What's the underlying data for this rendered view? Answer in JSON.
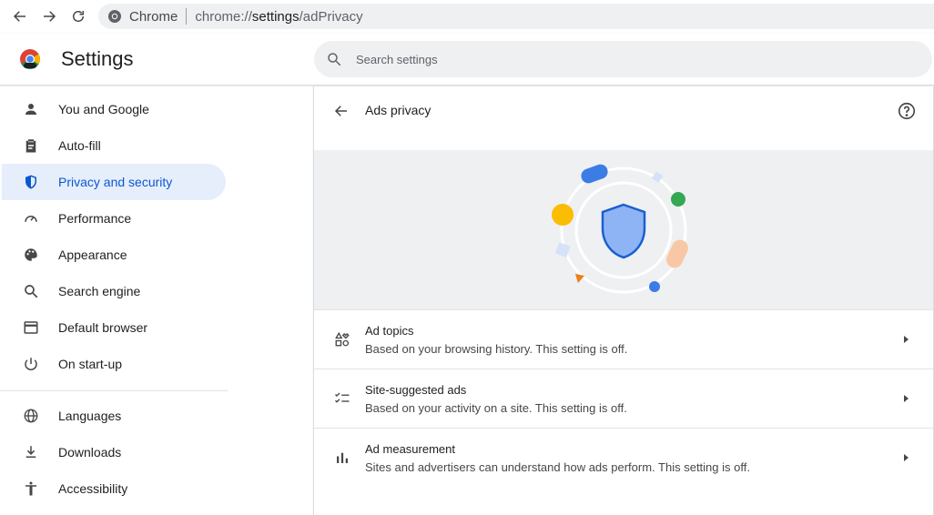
{
  "browser": {
    "site_name": "Chrome",
    "url_prefix": "chrome://",
    "url_host": "settings",
    "url_path": "/adPrivacy"
  },
  "header": {
    "title": "Settings",
    "search_placeholder": "Search settings"
  },
  "sidebar": {
    "items": [
      {
        "label": "You and Google",
        "icon": "person-icon"
      },
      {
        "label": "Auto-fill",
        "icon": "clipboard-icon"
      },
      {
        "label": "Privacy and security",
        "icon": "shield-icon",
        "active": true
      },
      {
        "label": "Performance",
        "icon": "speedometer-icon"
      },
      {
        "label": "Appearance",
        "icon": "palette-icon"
      },
      {
        "label": "Search engine",
        "icon": "search-icon"
      },
      {
        "label": "Default browser",
        "icon": "browser-window-icon"
      },
      {
        "label": "On start-up",
        "icon": "power-icon"
      },
      {
        "label": "Languages",
        "icon": "globe-icon"
      },
      {
        "label": "Downloads",
        "icon": "download-icon"
      },
      {
        "label": "Accessibility",
        "icon": "accessibility-icon"
      }
    ]
  },
  "main": {
    "title": "Ads privacy",
    "rows": [
      {
        "title": "Ad topics",
        "subtitle": "Based on your browsing history. This setting is off.",
        "icon": "topics-icon"
      },
      {
        "title": "Site-suggested ads",
        "subtitle": "Based on your activity on a site. This setting is off.",
        "icon": "checklist-icon"
      },
      {
        "title": "Ad measurement",
        "subtitle": "Sites and advertisers can understand how ads perform. This setting is off.",
        "icon": "bar-chart-icon"
      }
    ]
  },
  "colors": {
    "accent": "#0b57d0",
    "active_bg": "#e6eefc",
    "hero_bg": "#eef0f2"
  }
}
